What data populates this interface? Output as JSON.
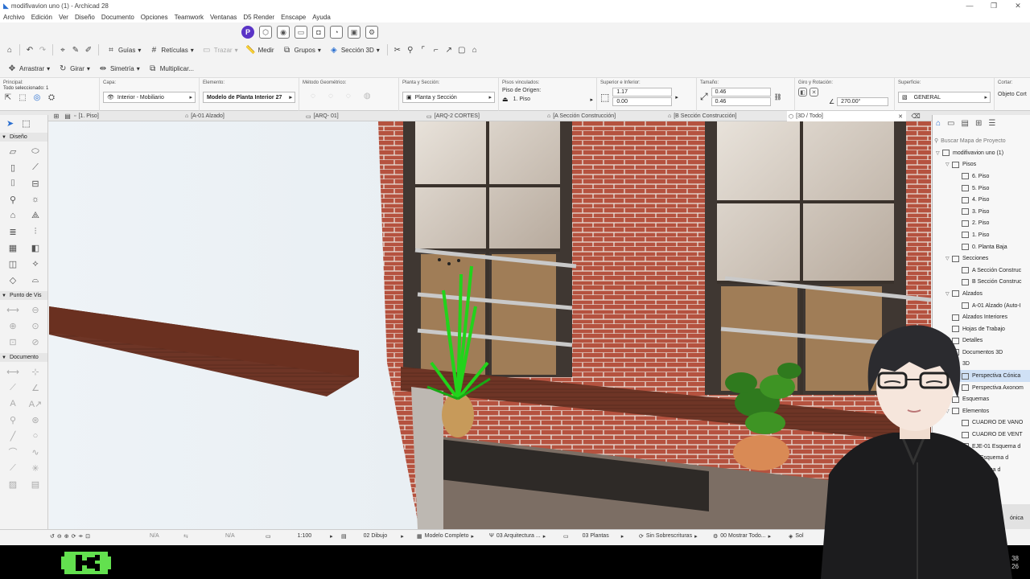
{
  "window": {
    "title": "modifivavion uno (1) - Archicad 28",
    "controls": [
      "—",
      "❐",
      "✕"
    ]
  },
  "menu": [
    "Archivo",
    "Edición",
    "Ver",
    "Diseño",
    "Documento",
    "Opciones",
    "Teamwork",
    "Ventanas",
    "D5 Render",
    "Enscape",
    "Ayuda"
  ],
  "toolbar1": {
    "guias": "Guías",
    "reticulas": "Retículas",
    "trazar": "Trazar",
    "medir": "Medir",
    "grupos": "Grupos",
    "seccion3d": "Sección 3D"
  },
  "toolbar2": {
    "arrastrar": "Arrastrar",
    "girar": "Girar",
    "simetria": "Simetría",
    "multiplicar": "Multiplicar..."
  },
  "infobox": {
    "principal_label": "Principal:",
    "principal_sub": "Todo seleccionado: 1",
    "capa_label": "Capa:",
    "capa_value": "Interior - Mobiliario",
    "elemento_label": "Elemento:",
    "elemento_value": "Modelo de Planta Interior 27",
    "metodo_label": "Método Geométrico:",
    "planta_label": "Planta y Sección:",
    "planta_value": "Planta y Sección",
    "pisos_label": "Pisos vinculados:",
    "piso_origen_label": "Piso de Origen:",
    "piso_origen_value": "1. Piso",
    "sup_label": "Superior e Inferior:",
    "sup_value": "1.17",
    "inf_value": "0.00",
    "tam_label": "Tamaño:",
    "tam_a": "0.46",
    "tam_b": "0.46",
    "giro_label": "Giro y Rotación:",
    "giro_value": "270.00°",
    "superficie_label": "Superficie:",
    "superficie_value": "GENERAL",
    "cortar_label": "Cortar:",
    "cortar_value": "Objeto Cort"
  },
  "tabs": [
    "[1. Piso]",
    "[A-01 Alzado]",
    "[ARQ- 01]",
    "[ARQ-2 CORTES]",
    "[A Sección Construcción]",
    "[B Sección Construcción]",
    "[3D / Todo]"
  ],
  "toolbox": {
    "sections": [
      "Diseño",
      "Punto de Vis",
      "Documento"
    ]
  },
  "navigator": {
    "search": "Buscar Mapa de Proyecto",
    "items": [
      {
        "label": "modifivavion uno (1)",
        "depth": 0,
        "twisty": "▽"
      },
      {
        "label": "Pisos",
        "depth": 1,
        "twisty": "▽"
      },
      {
        "label": "6. Piso",
        "depth": 2,
        "twisty": ""
      },
      {
        "label": "5. Piso",
        "depth": 2,
        "twisty": ""
      },
      {
        "label": "4. Piso",
        "depth": 2,
        "twisty": ""
      },
      {
        "label": "3. Piso",
        "depth": 2,
        "twisty": ""
      },
      {
        "label": "2. Piso",
        "depth": 2,
        "twisty": ""
      },
      {
        "label": "1. Piso",
        "depth": 2,
        "twisty": ""
      },
      {
        "label": "0. Planta Baja",
        "depth": 2,
        "twisty": ""
      },
      {
        "label": "Secciones",
        "depth": 1,
        "twisty": "▽"
      },
      {
        "label": "A Sección Construc",
        "depth": 2,
        "twisty": ""
      },
      {
        "label": "B Sección Construc",
        "depth": 2,
        "twisty": ""
      },
      {
        "label": "Alzados",
        "depth": 1,
        "twisty": "▽"
      },
      {
        "label": "A-01 Alzado (Auto-I",
        "depth": 2,
        "twisty": ""
      },
      {
        "label": "Alzados Interiores",
        "depth": 1,
        "twisty": ""
      },
      {
        "label": "Hojas de Trabajo",
        "depth": 1,
        "twisty": ""
      },
      {
        "label": "Detalles",
        "depth": 1,
        "twisty": ""
      },
      {
        "label": "Documentos 3D",
        "depth": 1,
        "twisty": ""
      },
      {
        "label": "3D",
        "depth": 1,
        "twisty": ""
      },
      {
        "label": "Perspectiva Cónica",
        "depth": 2,
        "twisty": "",
        "selected": true
      },
      {
        "label": "Perspectiva Axonom",
        "depth": 2,
        "twisty": ""
      },
      {
        "label": "Esquemas",
        "depth": 1,
        "twisty": ""
      },
      {
        "label": "Elementos",
        "depth": 1,
        "twisty": "▽"
      },
      {
        "label": "CUADRO DE VANO",
        "depth": 2,
        "twisty": ""
      },
      {
        "label": "CUADRO DE VENT",
        "depth": 2,
        "twisty": ""
      },
      {
        "label": "EJE-01 Esquema d",
        "depth": 2,
        "twisty": ""
      },
      {
        "label": "02 Esquema d",
        "depth": 2,
        "twisty": ""
      },
      {
        "label": "Esquema d",
        "depth": 2,
        "twisty": ""
      }
    ],
    "bottom_label": "ónica"
  },
  "statusbar": {
    "na1": "N/A",
    "na2": "N/A",
    "scale": "1:100",
    "dibujo": "02 Dibujo",
    "modelo": "Modelo Completo",
    "arquitectura": "03 Arquitectura ...",
    "plantas": "03 Plantas",
    "sobrescrituras": "Sin Sobrescrituras",
    "mostrar": "00 Mostrar Todo...",
    "sol": "Sol"
  },
  "corner": {
    "line1": "38",
    "line2": "26"
  },
  "colors": {
    "brick": "#b5523f",
    "accent": "#5a34c6",
    "wood": "#7a3b2a",
    "selection": "#cfe0f5"
  }
}
